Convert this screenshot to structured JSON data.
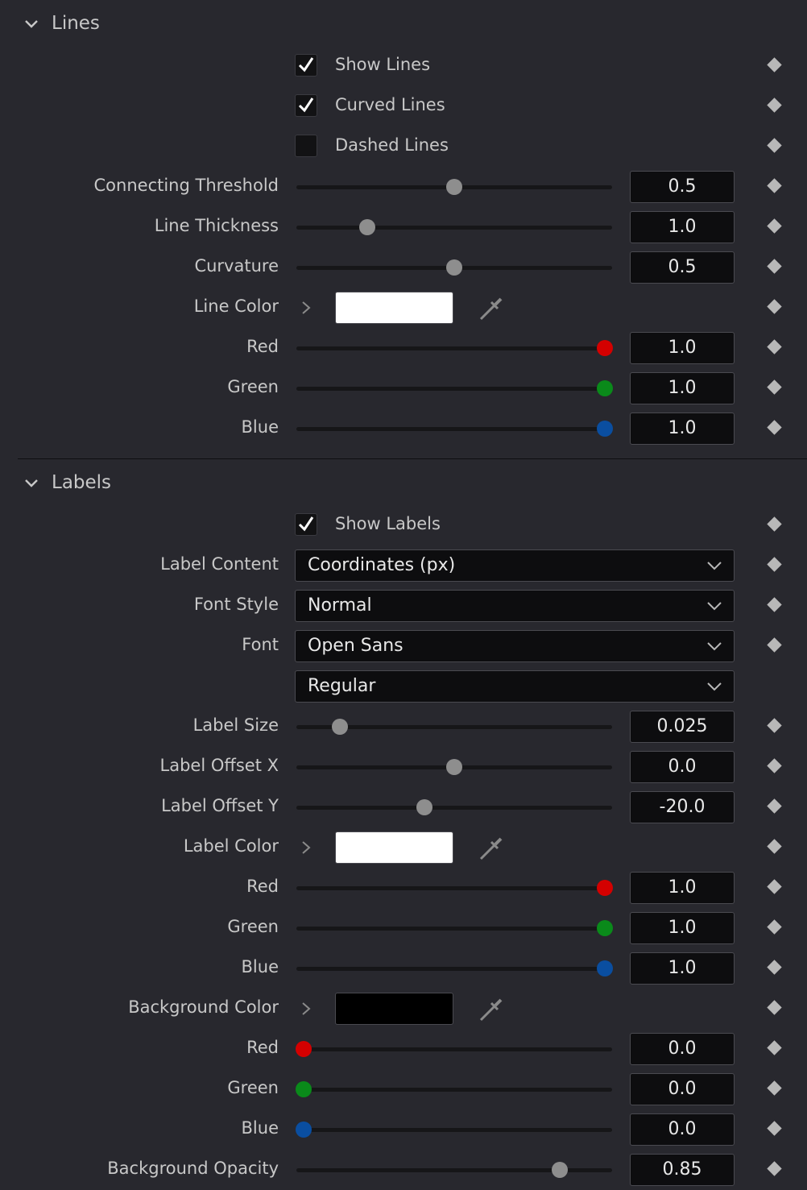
{
  "lines": {
    "title": "Lines",
    "show_lines": {
      "label": "Show Lines",
      "checked": true
    },
    "curved_lines": {
      "label": "Curved Lines",
      "checked": true
    },
    "dashed_lines": {
      "label": "Dashed Lines",
      "checked": false
    },
    "connecting_threshold": {
      "label": "Connecting Threshold",
      "value": "0.5",
      "fraction": 0.5
    },
    "line_thickness": {
      "label": "Line Thickness",
      "value": "1.0",
      "fraction": 0.21
    },
    "curvature": {
      "label": "Curvature",
      "value": "0.5",
      "fraction": 0.5
    },
    "line_color": {
      "label": "Line Color",
      "swatch": "#ffffff"
    },
    "red": {
      "label": "Red",
      "value": "1.0",
      "fraction": 1.0,
      "color": "#d40000"
    },
    "green": {
      "label": "Green",
      "value": "1.0",
      "fraction": 1.0,
      "color": "#0a8a1a"
    },
    "blue": {
      "label": "Blue",
      "value": "1.0",
      "fraction": 1.0,
      "color": "#0a4ea0"
    }
  },
  "labels": {
    "title": "Labels",
    "show_labels": {
      "label": "Show Labels",
      "checked": true
    },
    "label_content": {
      "label": "Label Content",
      "selected": "Coordinates (px)"
    },
    "font_style": {
      "label": "Font Style",
      "selected": "Normal"
    },
    "font": {
      "label": "Font",
      "selected": "Open Sans"
    },
    "font_weight": {
      "selected": "Regular"
    },
    "label_size": {
      "label": "Label Size",
      "value": "0.025",
      "fraction": 0.12
    },
    "label_offset_x": {
      "label": "Label Offset X",
      "value": "0.0",
      "fraction": 0.5
    },
    "label_offset_y": {
      "label": "Label Offset Y",
      "value": "-20.0",
      "fraction": 0.4
    },
    "label_color": {
      "label": "Label Color",
      "swatch": "#ffffff"
    },
    "label_red": {
      "label": "Red",
      "value": "1.0",
      "fraction": 1.0
    },
    "label_green": {
      "label": "Green",
      "value": "1.0",
      "fraction": 1.0
    },
    "label_blue": {
      "label": "Blue",
      "value": "1.0",
      "fraction": 1.0
    },
    "background_color": {
      "label": "Background Color",
      "swatch": "#000000"
    },
    "bg_red": {
      "label": "Red",
      "value": "0.0",
      "fraction": 0.0
    },
    "bg_green": {
      "label": "Green",
      "value": "0.0",
      "fraction": 0.0
    },
    "bg_blue": {
      "label": "Blue",
      "value": "0.0",
      "fraction": 0.0
    },
    "background_opacity": {
      "label": "Background Opacity",
      "value": "0.85",
      "fraction": 0.85
    }
  },
  "icons": {
    "section_chevron": "chevron-down-icon",
    "expand": "chevron-right-icon",
    "eyedropper": "eyedropper-icon",
    "keyframe": "keyframe-diamond-icon",
    "dropdown": "chevron-down-icon",
    "checkmark": "checkmark-icon"
  }
}
